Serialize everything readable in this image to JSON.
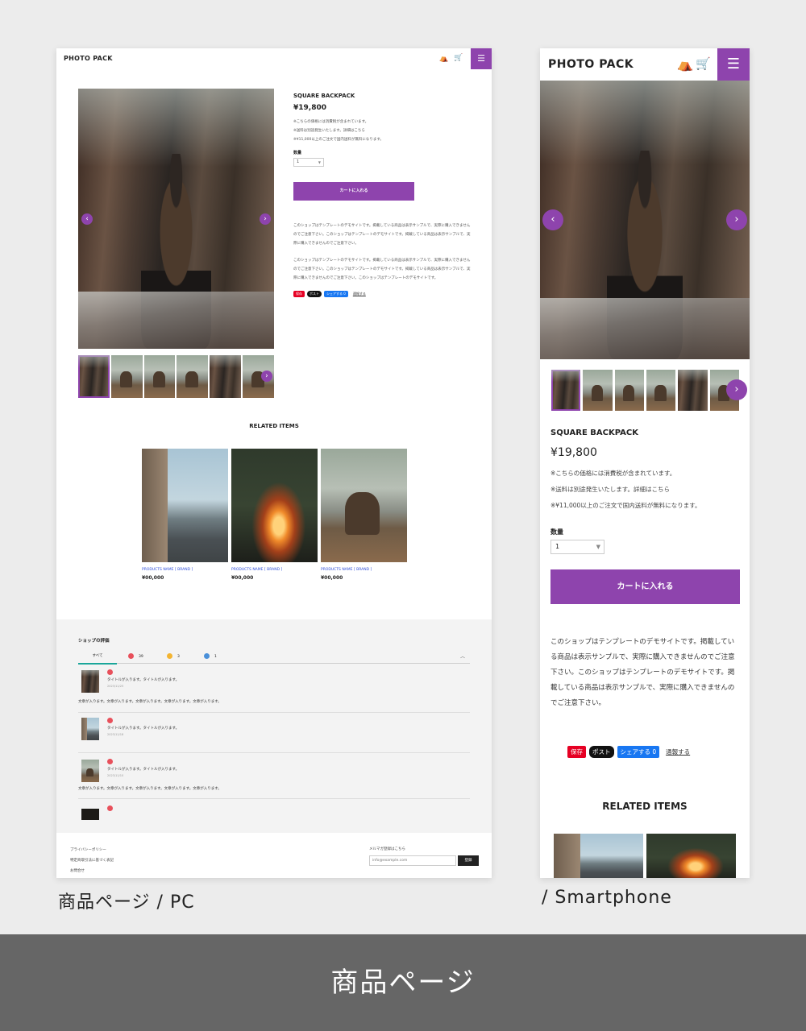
{
  "pc": {
    "header": {
      "logo": "PHOTO PACK",
      "tent_icon": "tent-icon",
      "cart_icon": "cart-icon",
      "menu_icon": "hamburger-icon"
    },
    "product": {
      "title": "SQUARE BACKPACK",
      "price": "¥19,800",
      "notes": [
        "※こちらの価格には消費税が含まれています。",
        "※送料は別途発生いたします。詳細はこちら",
        "※¥11,000以上のご注文で国内送料が無料になります。"
      ],
      "qty_label": "数量",
      "qty_value": "1",
      "cart_button": "カートに入れる",
      "description": [
        "このショップはテンプレートのデモサイトです。掲載している商品は表示サンプルで、実際に購入できませんのでご注意下さい。このショップはテンプレートのデモサイトです。掲載している商品は表示サンプルで、実際に購入できませんのでご注意下さい。",
        "このショップはテンプレートのデモサイトです。掲載している商品は表示サンプルで、実際に購入できませんのでご注意下さい。このショップはテンプレートのデモサイトです。掲載している商品は表示サンプルで、実際に購入できませんのでご注意下さい。このショップはテンプレートのデモサイトです。"
      ],
      "share": {
        "save": "保存",
        "post": "ポスト",
        "fb_share": "シェアする 0",
        "report": "通報する"
      }
    },
    "related": {
      "title": "RELATED ITEMS",
      "items": [
        {
          "name": "PRODUCTS NAME [ BRAND ]",
          "price": "¥00,000"
        },
        {
          "name": "PRODUCTS NAME [ BRAND ]",
          "price": "¥00,000"
        },
        {
          "name": "PRODUCTS NAME [ BRAND ]",
          "price": "¥00,000"
        }
      ]
    },
    "reviews": {
      "title": "ショップの評価",
      "tabs": {
        "all": "すべて",
        "good": "39",
        "normal": "3",
        "bad": "1"
      },
      "items": [
        {
          "title": "タイトルが入ります。タイトルが入ります。",
          "date": "2023/11/25",
          "body": "文章が入ります。文章が入ります。文章が入ります。文章が入ります。文章が入ります。"
        },
        {
          "title": "タイトルが入ります。タイトルが入ります。",
          "date": "2023/11/18",
          "body": ""
        },
        {
          "title": "タイトルが入ります。タイトルが入ります。",
          "date": "2023/11/10",
          "body": "文章が入ります。文章が入ります。文章が入ります。文章が入ります。文章が入ります。"
        }
      ]
    },
    "footer": {
      "links": [
        "プライバシーポリシー",
        "特定商取引法に基づく表記",
        "お問合せ"
      ],
      "mailmag_label": "メルマガ登録はこちら",
      "email_placeholder": "info@example.com",
      "submit": "登録"
    }
  },
  "sp": {
    "header": {
      "logo": "PHOTO PACK"
    },
    "product": {
      "title": "SQUARE BACKPACK",
      "price": "¥19,800",
      "notes": [
        "※こちらの価格には消費税が含まれています。",
        "※送料は別途発生いたします。詳細はこちら",
        "※¥11,000以上のご注文で国内送料が無料になります。"
      ],
      "qty_label": "数量",
      "qty_value": "1",
      "cart_button": "カートに入れる",
      "description": "このショップはテンプレートのデモサイトです。掲載している商品は表示サンプルで、実際に購入できませんのでご注意下さい。このショップはテンプレートのデモサイトです。掲載している商品は表示サンプルで、実際に購入できませんのでご注意下さい。",
      "share": {
        "save": "保存",
        "post": "ポスト",
        "fb_share": "シェアする 0",
        "report": "通報する"
      }
    },
    "related_title": "RELATED ITEMS"
  },
  "captions": {
    "pc": "商品ページ / PC",
    "sp": "/ Smartphone"
  },
  "banner": "商品ページ",
  "colors": {
    "accent": "#8e44ad",
    "banner_bg": "#666666",
    "page_bg": "#ececec"
  }
}
